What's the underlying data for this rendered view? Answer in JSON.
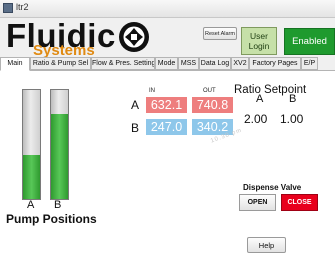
{
  "window": {
    "title": "ltr2"
  },
  "logo": {
    "brand": "Fluidic",
    "subtitle": "Systems"
  },
  "header": {
    "reset_alarm_label": "Reset Alarm",
    "user_login_line1": "User",
    "user_login_line2": "Login",
    "status_label": "Enabled"
  },
  "tabs": [
    {
      "label": "Main",
      "active": true
    },
    {
      "label": "Ratio & Pump Sel",
      "active": false
    },
    {
      "label": "Flow & Pres. Setting",
      "active": false
    },
    {
      "label": "Mode",
      "active": false
    },
    {
      "label": "MSS",
      "active": false
    },
    {
      "label": "Data Log",
      "active": false
    },
    {
      "label": "XV2",
      "active": false
    },
    {
      "label": "Factory Pages",
      "active": false
    },
    {
      "label": "E/P",
      "active": false
    }
  ],
  "pumps": {
    "a": {
      "label": "A",
      "level_fraction": 0.4
    },
    "b": {
      "label": "B",
      "level_fraction": 0.78
    },
    "caption": "Pump Positions"
  },
  "pressure": {
    "in_header": "IN",
    "out_header": "OUT",
    "row_a": {
      "label": "A",
      "in": "632.1",
      "out": "740.8"
    },
    "row_b": {
      "label": "B",
      "in": "247.0",
      "out": "340.2"
    }
  },
  "ratio_setpoint": {
    "title": "Ratio Setpoint",
    "a_label": "A",
    "b_label": "B",
    "a_value": "2.00",
    "b_value": "1.00"
  },
  "watermark": "10.30 pm",
  "dispense_valve": {
    "title": "Dispense Valve",
    "open_label": "OPEN",
    "close_label": "CLOSE"
  },
  "footer": {
    "help_label": "Help"
  },
  "colors": {
    "accent_orange": "#e08a12",
    "enabled_green": "#1f9a2e",
    "login_green": "#c6e0a8",
    "cell_red": "#ee7e7e",
    "cell_blue": "#8ec7ea",
    "close_red": "#e8001c"
  }
}
